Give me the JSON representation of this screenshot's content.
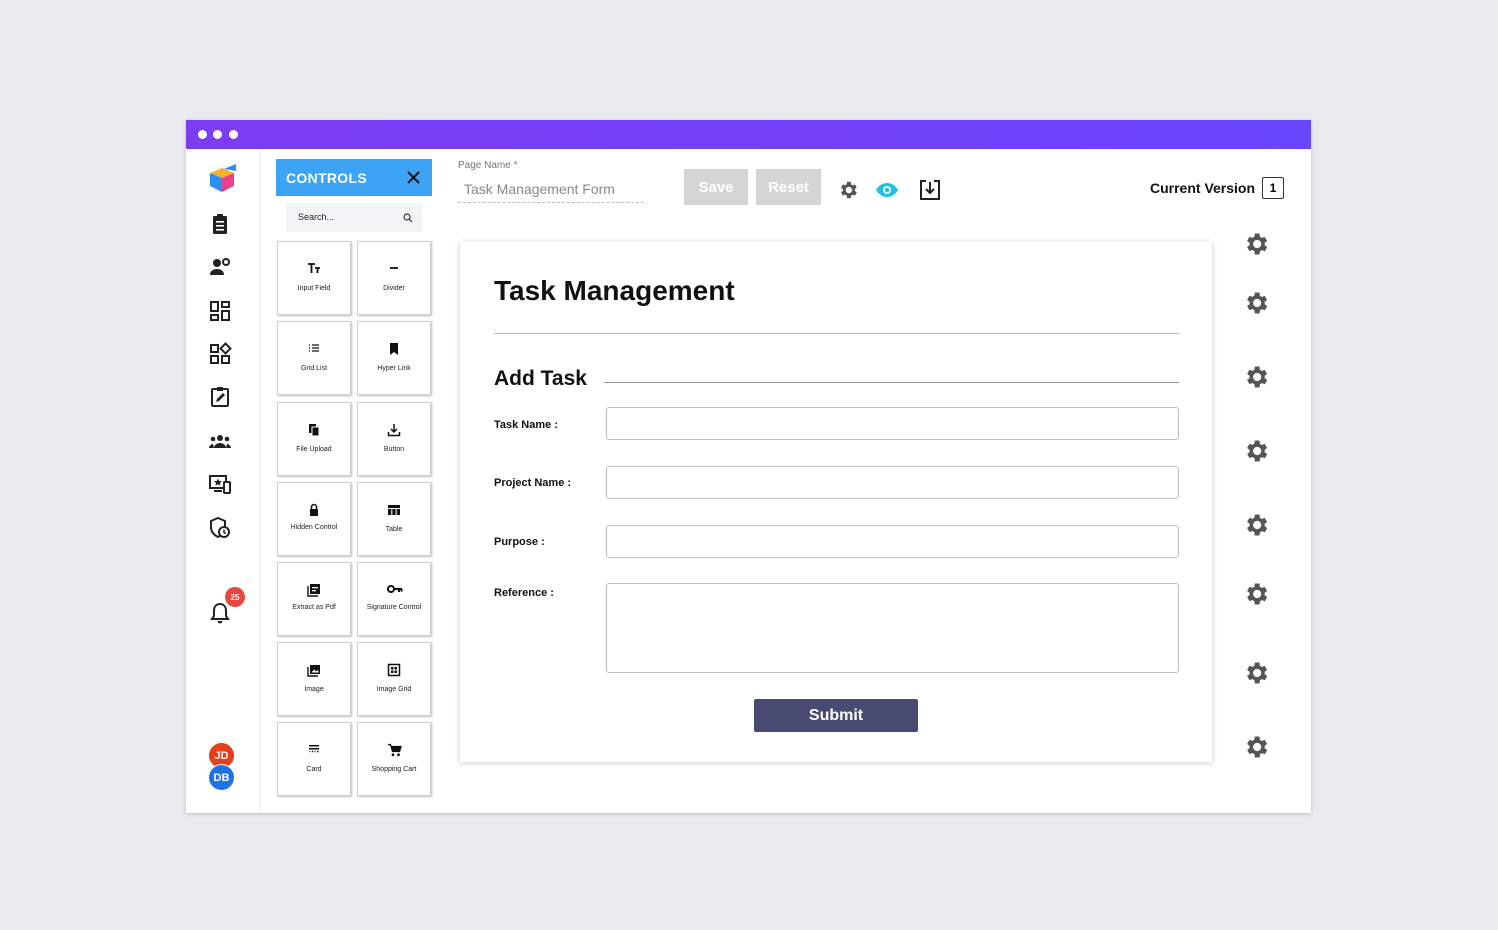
{
  "window": {
    "dots": 3
  },
  "sidebar": {
    "notification_count": "25",
    "users": [
      {
        "initials": "JD",
        "color": "#e4401c"
      },
      {
        "initials": "DB",
        "color": "#1f73e6"
      }
    ]
  },
  "controls": {
    "title": "CONTROLS",
    "search_placeholder": "Search...",
    "tiles": [
      {
        "label": "Input Field",
        "icon": "text-format-icon"
      },
      {
        "label": "Divider",
        "icon": "minus-icon"
      },
      {
        "label": "Grid List",
        "icon": "list-icon"
      },
      {
        "label": "Hyper Link",
        "icon": "bookmark-icon"
      },
      {
        "label": "File Upload",
        "icon": "file-copy-icon"
      },
      {
        "label": "Button",
        "icon": "download-icon"
      },
      {
        "label": "Hidden Control",
        "icon": "lock-icon"
      },
      {
        "label": "Table",
        "icon": "table-icon"
      },
      {
        "label": "Extract as Pdf",
        "icon": "pdf-icon"
      },
      {
        "label": "Signature Control",
        "icon": "key-icon"
      },
      {
        "label": "Image",
        "icon": "image-icon"
      },
      {
        "label": "Image Grid",
        "icon": "image-grid-icon"
      },
      {
        "label": "Card",
        "icon": "card-icon"
      },
      {
        "label": "Shopping Cart",
        "icon": "cart-icon"
      }
    ]
  },
  "toolbar": {
    "page_name_label": "Page Name *",
    "page_name_value": "Task Management Form",
    "save_label": "Save",
    "reset_label": "Reset",
    "current_version_label": "Current Version",
    "current_version_value": "1",
    "preview_color": "#1ec3e6"
  },
  "form": {
    "title": "Task Management",
    "section": "Add Task",
    "fields": [
      {
        "label": "Task Name :",
        "value": ""
      },
      {
        "label": "Project Name :",
        "value": ""
      },
      {
        "label": "Purpose :",
        "value": ""
      },
      {
        "label": "Reference :",
        "value": ""
      }
    ],
    "submit_label": "Submit"
  },
  "colors": {
    "titlebar": "#6a45ff",
    "controls_header": "#3da3f4",
    "submit": "#484a72",
    "badge": "#e7473f"
  }
}
